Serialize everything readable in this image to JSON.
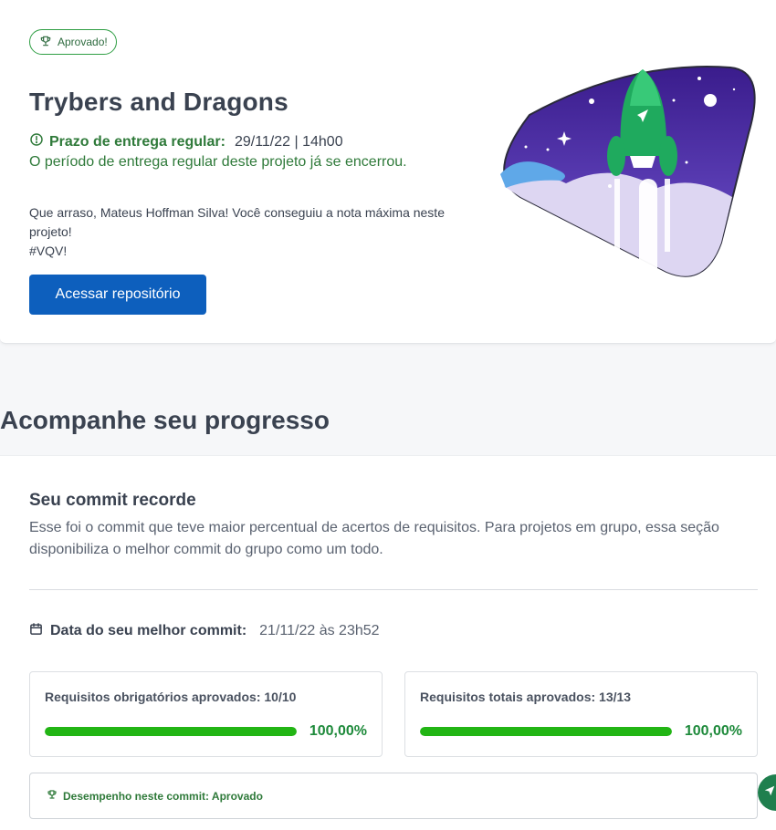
{
  "project": {
    "status_badge": "Aprovado!",
    "title": "Trybers and Dragons",
    "deadline_label": "Prazo de entrega regular:",
    "deadline_value": "29/11/22 | 14h00",
    "closed_text": "O período de entrega regular deste projeto já se encerrou.",
    "message_line1": "Que arraso, Mateus Hoffman Silva! Você conseguiu a nota máxima neste projeto!",
    "message_line2": "#VQV!",
    "repo_button": "Acessar repositório"
  },
  "progress": {
    "section_title": "Acompanhe seu progresso",
    "card_title": "Seu commit recorde",
    "card_desc": "Esse foi o commit que teve maior percentual de acertos de requisitos. Para projetos em grupo, essa seção disponibiliza o melhor commit do grupo como um todo.",
    "best_commit_label": "Data do seu melhor commit:",
    "best_commit_value": "21/11/22 às 23h52",
    "requirements": [
      {
        "label": "Requisitos obrigatórios aprovados: 10/10",
        "percent_text": "100,00%",
        "fraction": 1.0
      },
      {
        "label": "Requisitos totais aprovados: 13/13",
        "percent_text": "100,00%",
        "fraction": 1.0
      }
    ],
    "performance": "Desempenho neste commit: Aprovado"
  },
  "colors": {
    "accent_green": "#22b514",
    "primary_blue": "#0d5fbd",
    "success_text": "#2f7a3a"
  },
  "icons": [
    "trophy-icon",
    "alert-circle-icon",
    "calendar-icon",
    "send-icon"
  ]
}
